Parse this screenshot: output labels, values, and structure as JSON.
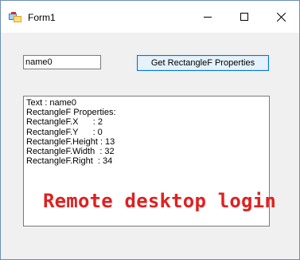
{
  "window": {
    "title": "Form1",
    "icon": "winforms-app-icon",
    "controls": {
      "minimize": "minimize-icon",
      "maximize": "maximize-icon",
      "close": "close-icon"
    }
  },
  "form": {
    "name_input_value": "name0",
    "button_label": "Get RectangleF Properties",
    "output_lines": [
      "Text : name0",
      "RectangleF Properties:",
      "RectangleF.X      : 2",
      "RectangleF.Y      : 0",
      "RectangleF.Height : 13",
      "RectangleF.Width  : 32",
      "RectangleF.Right  : 34"
    ]
  },
  "overlay": {
    "text": "Remote desktop login",
    "color": "#e02020"
  }
}
